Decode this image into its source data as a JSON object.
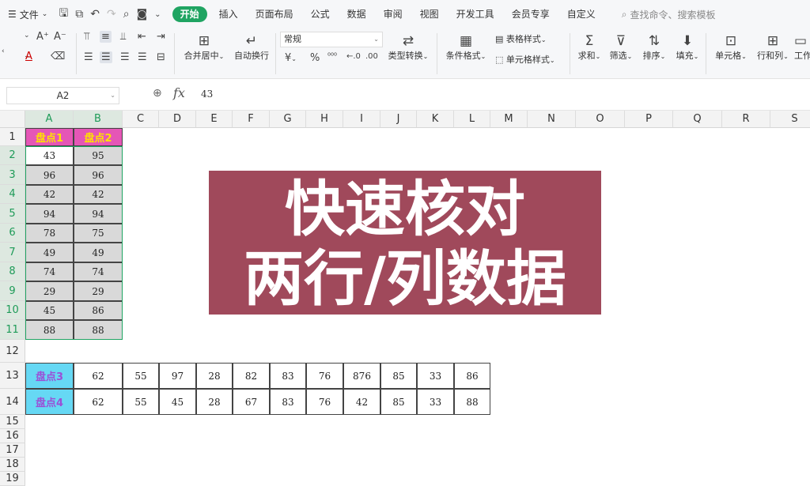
{
  "menubar": {
    "file_label": "文件",
    "tabs": [
      "开始",
      "插入",
      "页面布局",
      "公式",
      "数据",
      "审阅",
      "视图",
      "开发工具",
      "会员专享",
      "自定义"
    ],
    "search_placeholder": "查找命令、搜索模板"
  },
  "ribbon": {
    "merge_center": "合并居中",
    "wrap_text": "自动换行",
    "number_format": "常规",
    "type_convert": "类型转换",
    "conditional_format": "条件格式",
    "table_style": "表格样式",
    "cell_style": "单元格样式",
    "sum": "求和",
    "filter": "筛选",
    "sort": "排序",
    "fill": "填充",
    "cell": "单元格",
    "row_col": "行和列",
    "worksheet": "工作"
  },
  "formula_bar": {
    "name_box": "A2",
    "fx_label": "fx",
    "value": "43"
  },
  "sheet": {
    "columns": [
      "A",
      "B",
      "C",
      "D",
      "E",
      "F",
      "G",
      "H",
      "I",
      "J",
      "K",
      "L",
      "M",
      "N",
      "O",
      "P",
      "Q",
      "R",
      "S"
    ],
    "rows": [
      "1",
      "2",
      "3",
      "4",
      "5",
      "6",
      "7",
      "8",
      "9",
      "10",
      "11",
      "12",
      "13",
      "14",
      "15",
      "16",
      "17",
      "18",
      "19"
    ],
    "col_headers": [
      "盘点1",
      "盘点2"
    ],
    "col_data_a": [
      "43",
      "96",
      "42",
      "94",
      "78",
      "49",
      "74",
      "29",
      "45",
      "88"
    ],
    "col_data_b": [
      "95",
      "96",
      "42",
      "94",
      "75",
      "49",
      "74",
      "29",
      "86",
      "88"
    ],
    "row13_label": "盘点3",
    "row13_values": [
      "62",
      "55",
      "97",
      "28",
      "82",
      "83",
      "76",
      "876",
      "85",
      "33",
      "86"
    ],
    "row14_label": "盘点4",
    "row14_values": [
      "62",
      "55",
      "45",
      "28",
      "67",
      "83",
      "76",
      "42",
      "85",
      "33",
      "88"
    ]
  },
  "banner": {
    "line1": "快速核对",
    "line2": "两行/列数据"
  },
  "colors": {
    "accent": "#1fa462",
    "banner_bg": "#a0495b",
    "header_magenta": "#e556b6",
    "header_yellow": "#ffe100",
    "header_cyan": "#66d8f4",
    "header_violet": "#9b4fd6",
    "data_gray": "#d9d9d9"
  }
}
